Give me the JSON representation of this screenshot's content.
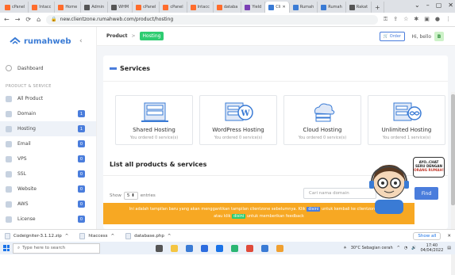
{
  "browser": {
    "tabs": [
      {
        "label": "cPanel",
        "color": "#ff6c2c"
      },
      {
        "label": "Intacc",
        "color": "#ff6c2c"
      },
      {
        "label": "Home",
        "color": "#ff6c2c"
      },
      {
        "label": "Admin",
        "color": "#555"
      },
      {
        "label": "WHM",
        "color": "#555"
      },
      {
        "label": "cPanel",
        "color": "#ff6c2c"
      },
      {
        "label": "cPanel",
        "color": "#ff6c2c"
      },
      {
        "label": "Intacc",
        "color": "#ff6c2c"
      },
      {
        "label": "databa",
        "color": "#ff6c2c"
      },
      {
        "label": "Yield",
        "color": "#7b3fb5"
      },
      {
        "label": "Cli",
        "color": "#3a7bd5"
      },
      {
        "label": "Rumah",
        "color": "#3a7bd5"
      },
      {
        "label": "Rumah",
        "color": "#3a7bd5"
      },
      {
        "label": "Rakat",
        "color": "#555"
      }
    ],
    "new_tab": "+",
    "url": "new.clientzone.rumahweb.com/product/hosting"
  },
  "sidebar": {
    "brand": "rumahweb",
    "dashboard": "Dashboard",
    "section": "PRODUCT & SERVICE",
    "items": [
      {
        "label": "All Product",
        "badge": ""
      },
      {
        "label": "Domain",
        "badge": "1"
      },
      {
        "label": "Hosting",
        "badge": "1"
      },
      {
        "label": "Email",
        "badge": "0"
      },
      {
        "label": "VPS",
        "badge": "0"
      },
      {
        "label": "SSL",
        "badge": "0"
      },
      {
        "label": "Website",
        "badge": "0"
      },
      {
        "label": "AWS",
        "badge": "0"
      },
      {
        "label": "License",
        "badge": "0"
      }
    ]
  },
  "topbar": {
    "crumb_product": "Product",
    "crumb_sep": ">",
    "crumb_hosting": "Hosting",
    "order": "Order",
    "greeting": "Hi, bello",
    "avatar": "B"
  },
  "services": {
    "title": "Services",
    "cards": [
      {
        "title": "Shared Hosting",
        "sub": "You ordered 0 service(s)"
      },
      {
        "title": "WordPress Hosting",
        "sub": "You ordered 0 service(s)"
      },
      {
        "title": "Cloud Hosting",
        "sub": "You ordered 0 service(s)"
      },
      {
        "title": "Unlimited Hosting",
        "sub": "You ordered 1 service(s)"
      }
    ]
  },
  "list": {
    "title": "List all products & services",
    "show": "Show",
    "entries_value": "5",
    "entries": "entries",
    "search_placeholder": "Cari nama domain",
    "find": "Find"
  },
  "notice": {
    "line1a": "Ini adalah tampilan baru yang akan menggantikan tampilan clientzone sebelumnya. Klik",
    "btn1": "disini",
    "line1b": "untuk kembali ke clientzone lama",
    "line2a": "atau klik",
    "btn2": "disini",
    "line2b": "untuk memberikan feedback"
  },
  "mascot": {
    "bubble1": "AYO..CHAT",
    "bubble2": "SERU DENGAN",
    "bubble3": "ORANG RUMAH!"
  },
  "downloads": {
    "items": [
      "Codeigniter-3.1.12.zip",
      "htaccess",
      "database.php"
    ],
    "show_all": "Show all"
  },
  "taskbar": {
    "search": "Type here to search",
    "weather": "30°C  Sebagian cerah",
    "time": "17:40",
    "date": "04/04/2022"
  }
}
